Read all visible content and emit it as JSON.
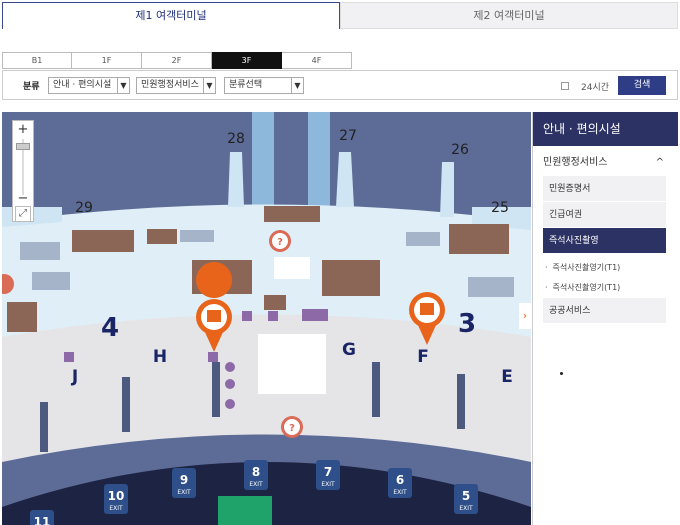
{
  "terminal_tabs": [
    {
      "label": "제1 여객터미널",
      "active": true
    },
    {
      "label": "제2 여객터미널",
      "active": false
    }
  ],
  "floor_tabs": [
    {
      "label": "B1",
      "active": false
    },
    {
      "label": "1F",
      "active": false
    },
    {
      "label": "2F",
      "active": false
    },
    {
      "label": "3F",
      "active": true
    },
    {
      "label": "4F",
      "active": false
    }
  ],
  "filter": {
    "label": "분류",
    "select1": "안내 · 편의시설",
    "select2": "민원행정서비스",
    "select3": "분류선택",
    "checkbox_label": "24시간",
    "search_label": "검색"
  },
  "map": {
    "zoom_in": "+",
    "zoom_out": "−",
    "gates_top": [
      "29",
      "28",
      "27",
      "26",
      "25"
    ],
    "zones": [
      "4",
      "3",
      "H",
      "G",
      "F",
      "J",
      "E"
    ],
    "exits": [
      "11",
      "10",
      "9",
      "8",
      "7",
      "6",
      "5"
    ],
    "exit_label": "EXIT",
    "next_arrow": "›"
  },
  "panel": {
    "title": "안내 · 편의시설",
    "category": "민원행정서비스",
    "items": [
      "민원증명서",
      "긴급여권",
      "즉석사진촬영"
    ],
    "active_item": "즉석사진촬영",
    "sub_items": [
      "즉석사진촬영기(T1)",
      "즉석사진촬영기(T1)"
    ],
    "last_item": "공공서비스"
  },
  "colors": {
    "brand_navy": "#2c3263",
    "accent_orange": "#e8641b",
    "exit_blue": "#2e4f8a",
    "teal": "#1fa36b"
  }
}
